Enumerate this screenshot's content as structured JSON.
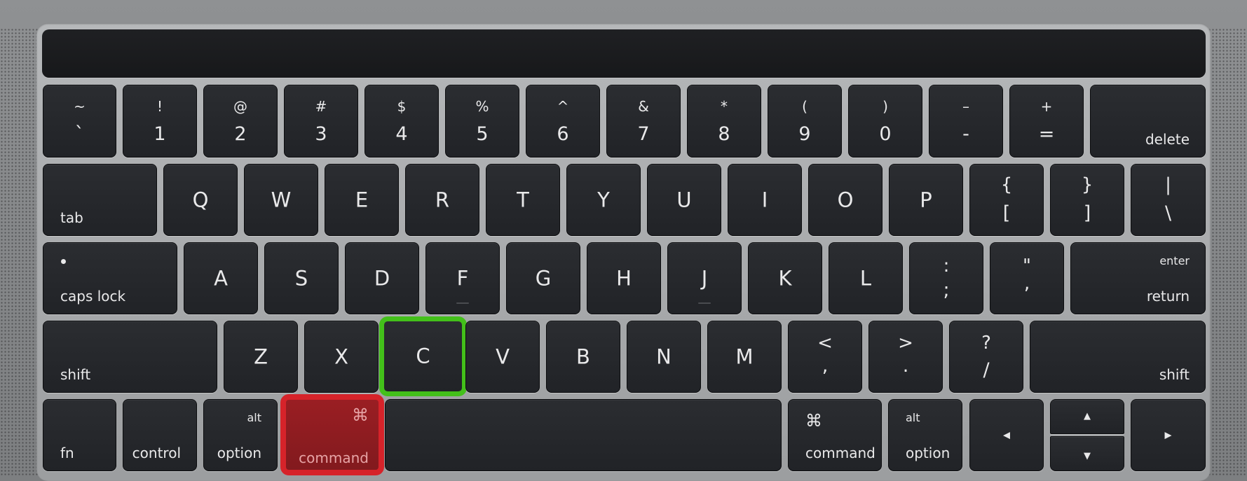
{
  "highlight_colors": {
    "command_key": "#d6232a",
    "c_key": "#43c01a"
  },
  "number_row": [
    {
      "top": "~",
      "bottom": "`"
    },
    {
      "top": "!",
      "bottom": "1"
    },
    {
      "top": "@",
      "bottom": "2"
    },
    {
      "top": "#",
      "bottom": "3"
    },
    {
      "top": "$",
      "bottom": "4"
    },
    {
      "top": "%",
      "bottom": "5"
    },
    {
      "top": "^",
      "bottom": "6"
    },
    {
      "top": "&",
      "bottom": "7"
    },
    {
      "top": "*",
      "bottom": "8"
    },
    {
      "top": "(",
      "bottom": "9"
    },
    {
      "top": ")",
      "bottom": "0"
    },
    {
      "top": "–",
      "bottom": "-"
    },
    {
      "top": "+",
      "bottom": "="
    },
    {
      "label": "delete"
    }
  ],
  "qwerty_row": {
    "tab": "tab",
    "letters": [
      "Q",
      "W",
      "E",
      "R",
      "T",
      "Y",
      "U",
      "I",
      "O",
      "P"
    ],
    "brackets": [
      {
        "top": "{",
        "bottom": "["
      },
      {
        "top": "}",
        "bottom": "]"
      },
      {
        "top": "|",
        "bottom": "\\"
      }
    ]
  },
  "home_row": {
    "caps_lock": "caps lock",
    "letters": [
      "A",
      "S",
      "D",
      "F",
      "G",
      "H",
      "J",
      "K",
      "L"
    ],
    "punct": [
      {
        "top": ":",
        "bottom": ";"
      },
      {
        "top": "\"",
        "bottom": ","
      }
    ],
    "return_top": "enter",
    "return": "return"
  },
  "bottom_letter_row": {
    "shift_left": "shift",
    "letters": [
      "Z",
      "X",
      "C",
      "V",
      "B",
      "N",
      "M"
    ],
    "punct": [
      {
        "top": "<",
        "bottom": ","
      },
      {
        "top": ">",
        "bottom": "."
      },
      {
        "top": "?",
        "bottom": "/"
      }
    ],
    "shift_right": "shift"
  },
  "modifier_row": {
    "fn": "fn",
    "control": "control",
    "option_left": {
      "top": "alt",
      "label": "option"
    },
    "command_left": {
      "symbol": "⌘",
      "label": "command"
    },
    "command_right": {
      "symbol": "⌘",
      "label": "command"
    },
    "option_right": {
      "top": "alt",
      "label": "option"
    },
    "arrows": {
      "left": "◀",
      "up": "▲",
      "down": "▼",
      "right": "▶"
    }
  }
}
